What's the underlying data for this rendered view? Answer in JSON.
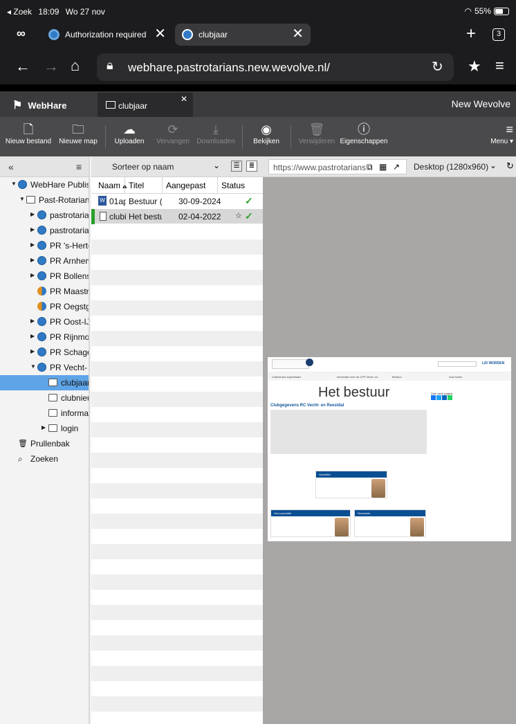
{
  "status_bar": {
    "back_app": "◂ Zoek",
    "time": "18:09",
    "date": "Wo 27 nov",
    "battery": "55%"
  },
  "browser": {
    "tabs": [
      {
        "label": "Authorization required"
      },
      {
        "label": "clubjaar"
      }
    ],
    "tab_count": "3",
    "url": "webhare.pastrotarians.new.wevolve.nl/"
  },
  "webhare": {
    "brand": "WebHare",
    "open_tab": "clubjaar",
    "site_name": "New Wevolve",
    "toolbar": {
      "new_file": "Nieuw bestand",
      "new_folder": "Nieuwe map",
      "upload": "Uploaden",
      "replace": "Vervangen",
      "download": "Downloaden",
      "view": "Bekijken",
      "delete": "Verwijderen",
      "properties": "Eigenschappen",
      "menu": "Menu ▾"
    },
    "tree": [
      {
        "label": "WebHare Publishe",
        "level": 0,
        "arrow": "▼",
        "icon": "globe"
      },
      {
        "label": "Past-Rotarians",
        "level": 1,
        "arrow": "▼",
        "icon": "folder"
      },
      {
        "label": "pastrotarian",
        "level": 2,
        "arrow": "▶",
        "icon": "globe"
      },
      {
        "label": "pastrotarian",
        "level": 2,
        "arrow": "▶",
        "icon": "globe"
      },
      {
        "label": "PR 's-Hertog",
        "level": 2,
        "arrow": "▶",
        "icon": "globe"
      },
      {
        "label": "PR Arnhem-",
        "level": 2,
        "arrow": "▶",
        "icon": "globe"
      },
      {
        "label": "PR Bollenst",
        "level": 2,
        "arrow": "▶",
        "icon": "globe"
      },
      {
        "label": "PR Maastric",
        "level": 2,
        "arrow": "",
        "icon": "globe-half"
      },
      {
        "label": "PR Oegstge",
        "level": 2,
        "arrow": "",
        "icon": "globe-half"
      },
      {
        "label": "PR Oost-IJs",
        "level": 2,
        "arrow": "▶",
        "icon": "globe"
      },
      {
        "label": "PR Rijnmon",
        "level": 2,
        "arrow": "▶",
        "icon": "globe"
      },
      {
        "label": "PR Schager",
        "level": 2,
        "arrow": "▶",
        "icon": "globe"
      },
      {
        "label": "PR Vecht- e",
        "level": 2,
        "arrow": "▼",
        "icon": "globe"
      },
      {
        "label": "clubjaar",
        "level": 3,
        "arrow": "",
        "icon": "folder",
        "selected": true
      },
      {
        "label": "clubnieu",
        "level": 3,
        "arrow": "",
        "icon": "folder"
      },
      {
        "label": "informat",
        "level": 3,
        "arrow": "",
        "icon": "folder"
      },
      {
        "label": "login",
        "level": 3,
        "arrow": "▶",
        "icon": "folder"
      },
      {
        "label": "Prullenbak",
        "level": 0,
        "arrow": "",
        "icon": "trash"
      },
      {
        "label": "Zoeken",
        "level": 0,
        "arrow": "",
        "icon": "search-folder"
      }
    ],
    "filelist": {
      "sort_label": "Sorteer op naam",
      "columns": [
        "Naam ▴",
        "Titel",
        "Aangepast",
        "Status"
      ],
      "rows": [
        {
          "name": "01ap",
          "title": "Bestuur (F",
          "modified": "30-09-2024",
          "status": "✓"
        },
        {
          "name": "clubi",
          "title": "Het bestuu",
          "modified": "02-04-2022",
          "status": "✓",
          "selected": true
        }
      ]
    },
    "preview": {
      "url": "https://www.pastrotarians...",
      "device": "Desktop (1280x960)",
      "page": {
        "title": "Het bestuur",
        "subtitle": "Clubgegevens RC Vecht- en Reestdal",
        "menu": [
          "Clubnieuws expertkaart",
          "Informatie over de CPP Vecht- en",
          "Bestuur",
          "Voor leden"
        ],
        "cta": "LID WORDEN",
        "share_label": "Deel deze pagina:",
        "cards": [
          "Voorzitter",
          "Oud-voorzitter",
          "Secretaris"
        ]
      }
    }
  }
}
